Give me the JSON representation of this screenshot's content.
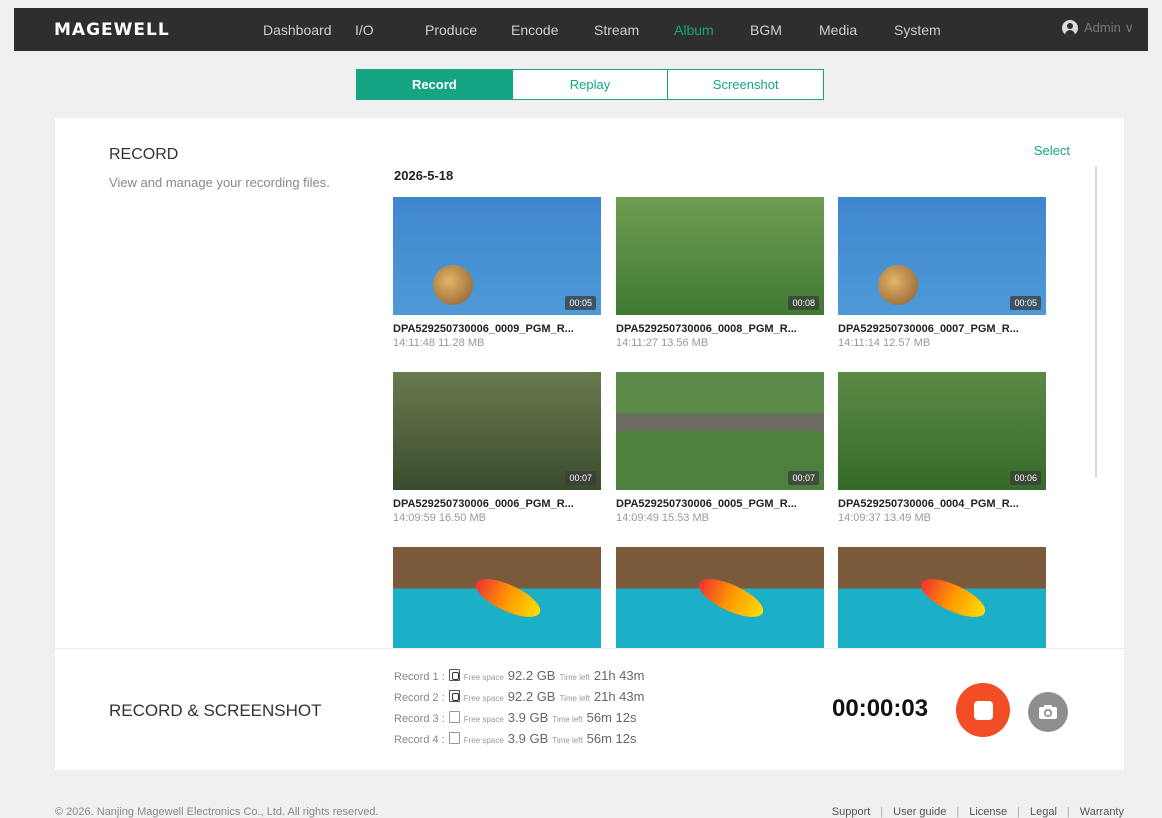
{
  "app": {
    "logo": "MAGEWELL",
    "nav": [
      "Dashboard",
      "I/O",
      "Produce",
      "Encode",
      "Stream",
      "Album",
      "BGM",
      "Media",
      "System"
    ],
    "active_nav": "Album",
    "user": "Admin ∨"
  },
  "tabs": [
    "Record",
    "Replay",
    "Screenshot"
  ],
  "active_tab": "Record",
  "record": {
    "title": "RECORD",
    "description": "View and manage your recording files.",
    "select_label": "Select",
    "date": "2026-5-18",
    "items": [
      {
        "name": "DPA529250730006_0009_PGM_R...",
        "time": "14:11:48",
        "size": "11.28 MB",
        "duration": "00:05",
        "art": "sky"
      },
      {
        "name": "DPA529250730006_0008_PGM_R...",
        "time": "14:11:27",
        "size": "13.56 MB",
        "duration": "00:08",
        "art": "field"
      },
      {
        "name": "DPA529250730006_0007_PGM_R...",
        "time": "14:11:14",
        "size": "12.57 MB",
        "duration": "00:05",
        "art": "sky"
      },
      {
        "name": "DPA529250730006_0006_PGM_R...",
        "time": "14:09:59",
        "size": "16.50 MB",
        "duration": "00:07",
        "art": "crowd"
      },
      {
        "name": "DPA529250730006_0005_PGM_R...",
        "time": "14:09:49",
        "size": "15.53 MB",
        "duration": "00:07",
        "art": "diamond"
      },
      {
        "name": "DPA529250730006_0004_PGM_R...",
        "time": "14:09:37",
        "size": "13.49 MB",
        "duration": "00:06",
        "art": "green"
      },
      {
        "name": "",
        "time": "",
        "size": "",
        "duration": "",
        "art": "surf"
      },
      {
        "name": "",
        "time": "",
        "size": "",
        "duration": "",
        "art": "surf"
      },
      {
        "name": "",
        "time": "",
        "size": "",
        "duration": "",
        "art": "surf"
      }
    ]
  },
  "panel": {
    "title": "RECORD & SCREENSHOT",
    "records": [
      {
        "label": "Record 1 :",
        "disk": "full",
        "free_label": "Free space",
        "free": "92.2 GB",
        "left_label": "Time left",
        "left": "21h 43m"
      },
      {
        "label": "Record 2 :",
        "disk": "full",
        "free_label": "Free space",
        "free": "92.2 GB",
        "left_label": "Time left",
        "left": "21h 43m"
      },
      {
        "label": "Record 3 :",
        "disk": "empty",
        "free_label": "Free space",
        "free": "3.9 GB",
        "left_label": "Time left",
        "left": "56m 12s"
      },
      {
        "label": "Record 4 :",
        "disk": "empty",
        "free_label": "Free space",
        "free": "3.9 GB",
        "left_label": "Time left",
        "left": "56m 12s"
      }
    ],
    "timer": "00:00:03",
    "stop_color": "#f24d25",
    "stop_icon": "stop-icon",
    "camera_icon": "camera-icon"
  },
  "footer": {
    "copyright": "© 2026. Nanjing Magewell Electronics Co., Ltd. All rights reserved.",
    "links": [
      "Support",
      "User guide",
      "License",
      "Legal",
      "Warranty"
    ]
  },
  "colors": {
    "accent": "#16a583",
    "topbar": "#2e2e2e"
  }
}
